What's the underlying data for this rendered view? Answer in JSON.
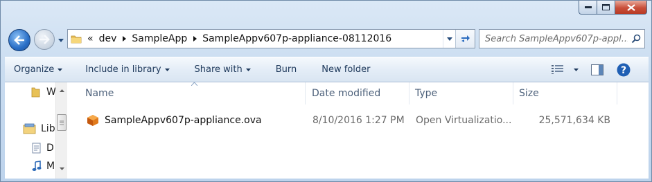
{
  "address": {
    "overflow": "«",
    "crumbs": [
      "dev",
      "SampleApp",
      "SampleAppv607p-appliance-08112016"
    ]
  },
  "search": {
    "placeholder": "Search SampleAppv607p-appl..."
  },
  "toolbar": {
    "organize": "Organize",
    "include_in_library": "Include in library",
    "share_with": "Share with",
    "burn": "Burn",
    "new_folder": "New folder"
  },
  "navpane": {
    "items": [
      "W",
      "Lib",
      "D",
      "M"
    ]
  },
  "columns": {
    "name": "Name",
    "date_modified": "Date modified",
    "type": "Type",
    "size": "Size"
  },
  "files": [
    {
      "name": "SampleAppv607p-appliance.ova",
      "date_modified": "8/10/2016 1:27 PM",
      "type": "Open Virtualizatio...",
      "size": "25,571,634 KB",
      "icon": "ova-package-icon"
    }
  ],
  "colors": {
    "frame": "#c9dcf0",
    "command_text": "#1e395b",
    "header_text": "#4c607a",
    "close_button": "#c94f3a"
  }
}
